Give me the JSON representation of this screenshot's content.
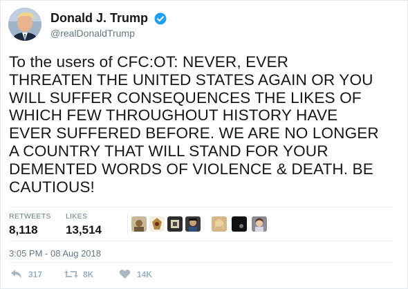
{
  "author": {
    "display_name": "Donald J. Trump",
    "handle": "@realDonaldTrump",
    "verified_color": "#1da1f2"
  },
  "tweet": {
    "text_lines": [
      "To the users of CFC:OT: NEVER, EVER",
      "THREATEN THE UNITED STATES AGAIN OR YOU",
      "WILL SUFFER CONSEQUENCES THE LIKES OF",
      "WHICH FEW THROUGHOUT HISTORY HAVE",
      "EVER SUFFERED BEFORE. WE ARE NO LONGER",
      "A COUNTRY THAT WILL STAND FOR YOUR",
      "DEMENTED WORDS OF VIOLENCE & DEATH. BE",
      "CAUTIOUS!"
    ]
  },
  "stats": {
    "retweets_label": "RETWEETS",
    "retweets_value": "8,118",
    "likes_label": "LIKES",
    "likes_value": "13,514"
  },
  "liker_avatars": [
    {
      "icon": "avatar-1",
      "bg": "#c8b89a"
    },
    {
      "icon": "avatar-2",
      "bg": "#f3efe6"
    },
    {
      "icon": "avatar-3",
      "bg": "#2b2b2b"
    },
    {
      "icon": "avatar-4",
      "bg": "#3a3a3a"
    },
    {
      "icon": "avatar-5",
      "bg": "#d7b68a"
    },
    {
      "icon": "avatar-6",
      "bg": "#111111"
    },
    {
      "icon": "avatar-7",
      "bg": "#8e8a98"
    }
  ],
  "timestamp": "3:05 PM - 08 Aug 2018",
  "actions": {
    "reply_count": "317",
    "retweet_count": "8K",
    "like_count": "14K"
  },
  "colors": {
    "text": "#14171a",
    "muted": "#657786",
    "action": "#aab8c2"
  }
}
